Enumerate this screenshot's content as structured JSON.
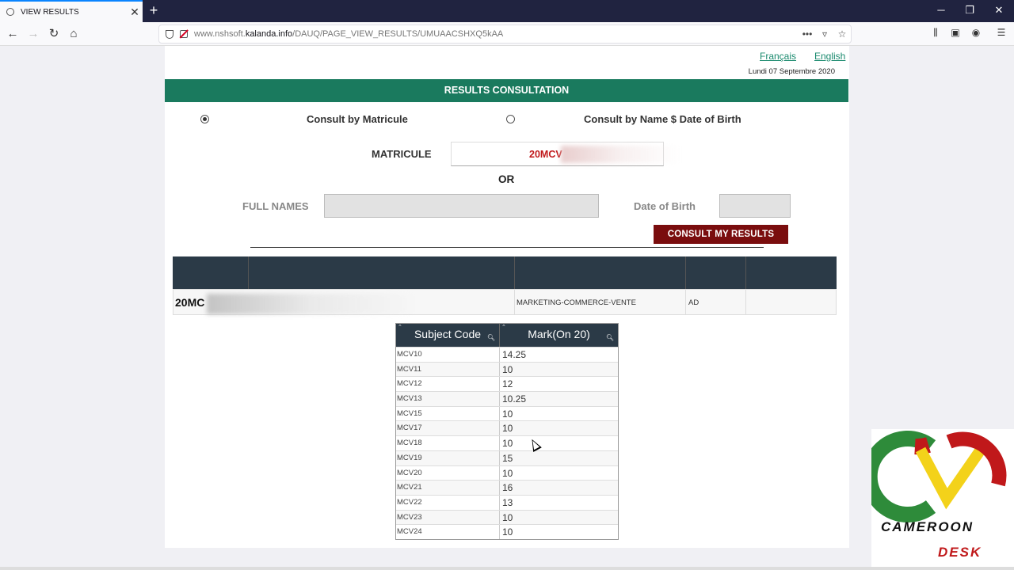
{
  "browser": {
    "tab_title": "VIEW RESULTS",
    "url_prefix": "www.nshsoft.",
    "url_domain": "kalanda.info",
    "url_path": "/DAUQ/PAGE_VIEW_RESULTS/UMUAACSHXQ5kAA"
  },
  "header": {
    "lang_fr": "Français",
    "lang_en": "English",
    "date": "Lundi 07 Septembre 2020",
    "banner": "RESULTS CONSULTATION"
  },
  "form": {
    "option_matricule": "Consult by Matricule",
    "option_name": "Consult by Name $ Date of Birth",
    "matricule_label": "MATRICULE",
    "matricule_value": "20MCV",
    "or_label": "OR",
    "fullnames_label": "FULL NAMES",
    "dob_label": "Date of Birth",
    "consult_button": "CONSULT MY RESULTS"
  },
  "result": {
    "matricule": "20MC",
    "speciality": "MARKETING-COMMERCE-VENTE",
    "decision": "AD"
  },
  "marks_table": {
    "headers": [
      "Subject Code",
      "Mark(On 20)"
    ],
    "rows": [
      {
        "code": "MCV10",
        "mark": "14.25"
      },
      {
        "code": "MCV11",
        "mark": "10"
      },
      {
        "code": "MCV12",
        "mark": "12"
      },
      {
        "code": "MCV13",
        "mark": "10.25"
      },
      {
        "code": "MCV15",
        "mark": "10"
      },
      {
        "code": "MCV17",
        "mark": "10"
      },
      {
        "code": "MCV18",
        "mark": "10"
      },
      {
        "code": "MCV19",
        "mark": "15"
      },
      {
        "code": "MCV20",
        "mark": "10"
      },
      {
        "code": "MCV21",
        "mark": "16"
      },
      {
        "code": "MCV22",
        "mark": "13"
      },
      {
        "code": "MCV23",
        "mark": "10"
      },
      {
        "code": "MCV24",
        "mark": "10"
      }
    ]
  },
  "watermark": {
    "line1": "CAMEROON",
    "line2": "DESK"
  },
  "colors": {
    "banner": "#1a7a5e",
    "button": "#7a0d0e",
    "table_header": "#2b3a47",
    "matricule_text": "#c0181a"
  }
}
